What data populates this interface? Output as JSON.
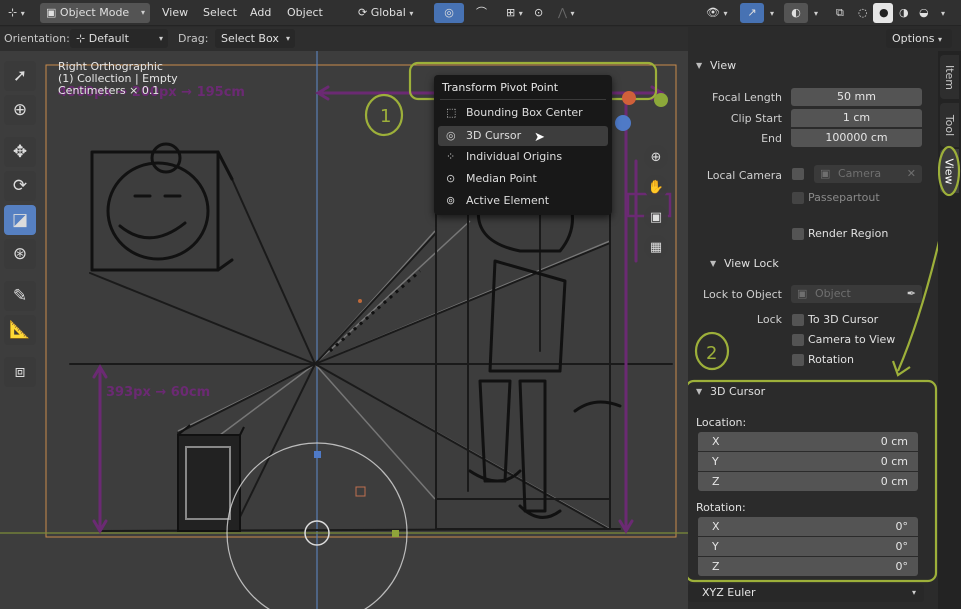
{
  "header": {
    "mode_label": "Object Mode",
    "menu_view": "View",
    "menu_select": "Select",
    "menu_add": "Add",
    "menu_object": "Object",
    "transform_orientation": "Global"
  },
  "tool_settings": {
    "orientation_label": "Orientation:",
    "orientation_value": "Default",
    "drag_label": "Drag:",
    "drag_value": "Select Box",
    "options_label": "Options"
  },
  "viewport": {
    "overlay_lines": [
      "Right Orthographic",
      "(1) Collection | Empty",
      "Centimeters × 0.1"
    ],
    "annotations": {
      "top_measure": "4000px → 200px → 195cm",
      "left_measure": "393px → 60cm",
      "step_one": "1",
      "step_two": "2"
    }
  },
  "pivot_popup": {
    "title": "Transform Pivot Point",
    "items": [
      {
        "label": "Bounding Box Center",
        "icon": "bounding-box-icon"
      },
      {
        "label": "3D Cursor",
        "icon": "cursor-3d-icon",
        "selected": true
      },
      {
        "label": "Individual Origins",
        "icon": "individual-origins-icon"
      },
      {
        "label": "Median Point",
        "icon": "median-point-icon"
      },
      {
        "label": "Active Element",
        "icon": "active-element-icon"
      }
    ]
  },
  "sidebar": {
    "tabs": [
      "Item",
      "Tool",
      "View"
    ],
    "active_tab": "View",
    "view_panel": {
      "title": "View",
      "focal_length_label": "Focal Length",
      "focal_length_value": "50 mm",
      "clip_start_label": "Clip Start",
      "clip_start_value": "1 cm",
      "end_label": "End",
      "end_value": "100000 cm",
      "local_camera_label": "Local Camera",
      "camera_placeholder": "Camera",
      "passepartout_label": "Passepartout",
      "render_region_label": "Render Region"
    },
    "view_lock_panel": {
      "title": "View Lock",
      "lock_to_object_label": "Lock to Object",
      "object_placeholder": "Object",
      "lock_label": "Lock",
      "to_3d_cursor_label": "To 3D Cursor",
      "camera_to_view_label": "Camera to View",
      "rotation_label": "Rotation"
    },
    "cursor_panel": {
      "title": "3D Cursor",
      "location_label": "Location:",
      "location": [
        {
          "axis": "X",
          "value": "0 cm"
        },
        {
          "axis": "Y",
          "value": "0 cm"
        },
        {
          "axis": "Z",
          "value": "0 cm"
        }
      ],
      "rotation_label": "Rotation:",
      "rotation": [
        {
          "axis": "X",
          "value": "0°"
        },
        {
          "axis": "Y",
          "value": "0°"
        },
        {
          "axis": "Z",
          "value": "0°"
        }
      ],
      "rotation_mode": "XYZ Euler"
    }
  },
  "colors": {
    "accent": "#4772b3",
    "annotation_green": "#9db03a",
    "annotation_purple": "#6b2a73",
    "popup_bg": "#181818"
  }
}
